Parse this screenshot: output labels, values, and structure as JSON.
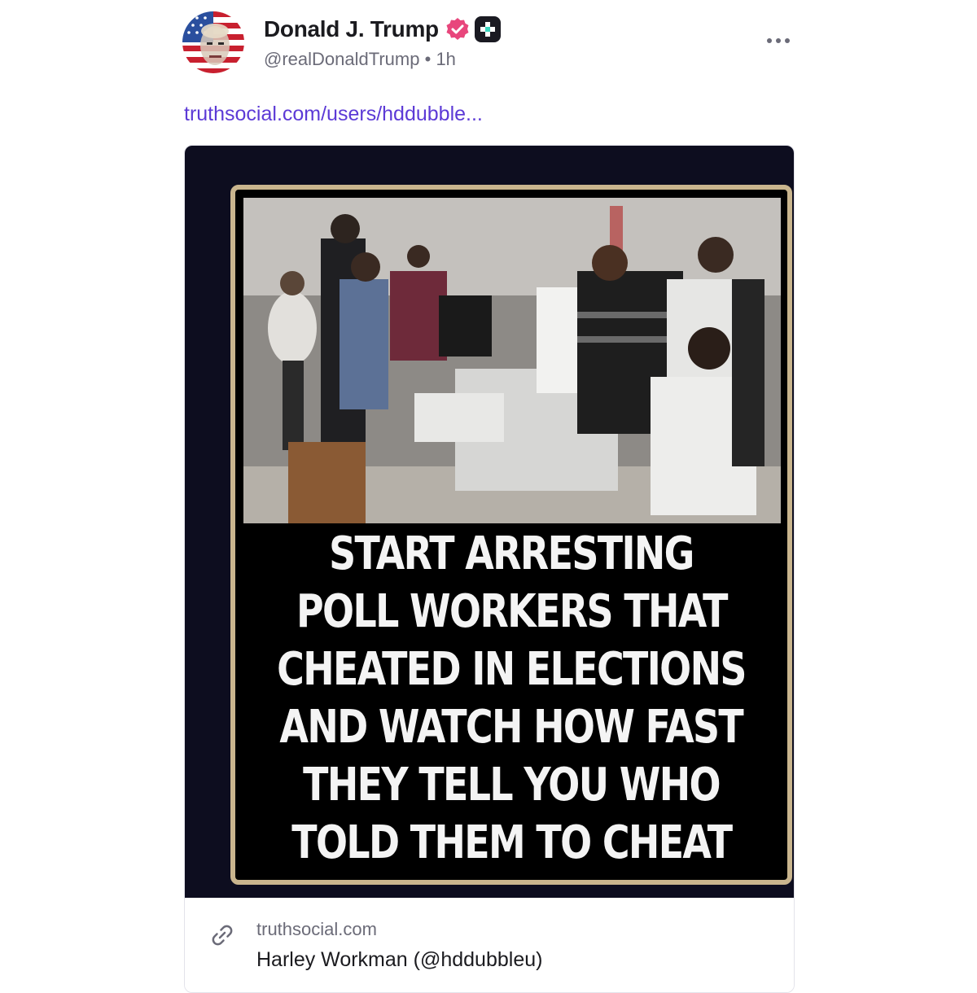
{
  "post": {
    "display_name": "Donald J. Trump",
    "handle": "@realDonaldTrump",
    "separator": "•",
    "time": "1h",
    "link_text": "truthsocial.com/users/hddubble..."
  },
  "icons": {
    "avatar": "avatar-flag-portrait",
    "verified": "verified-badge-icon",
    "plus": "plus-badge-icon",
    "more": "more-horizontal-icon",
    "link": "chain-link-icon"
  },
  "media": {
    "meme_lines": [
      "START ARRESTING",
      "POLL WORKERS THAT",
      "CHEATED IN ELECTIONS",
      "AND WATCH HOW FAST",
      "THEY TELL YOU WHO",
      "TOLD THEM TO CHEAT"
    ]
  },
  "link_preview": {
    "domain": "truthsocial.com",
    "title": "Harley Workman (@hddubbleu)"
  },
  "colors": {
    "link": "#5c3ad6",
    "verified": "#e8467c",
    "text_primary": "#1b1b1f",
    "text_secondary": "#6b6b78"
  }
}
